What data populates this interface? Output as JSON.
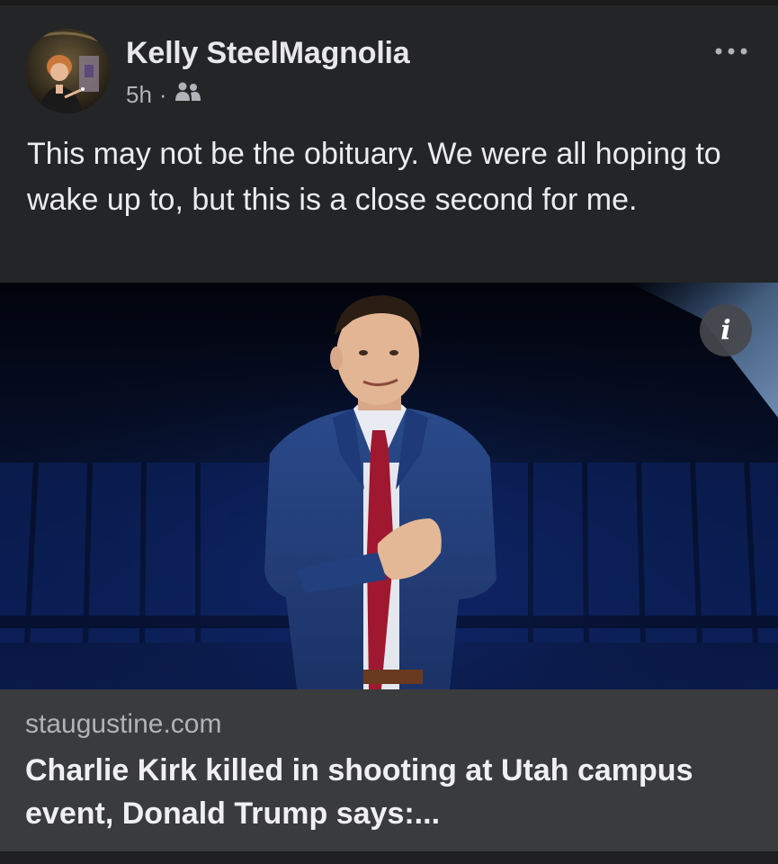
{
  "post": {
    "author_name": "Kelly SteelMagnolia",
    "timestamp": "5h",
    "separator": "·",
    "audience_icon": "friends-icon",
    "more_icon": "more-options-icon",
    "text": "This may not be the obituary. We were all hoping to wake up to, but this is a close second for me."
  },
  "photo": {
    "info_label": "i"
  },
  "link_preview": {
    "domain": "staugustine.com",
    "title": "Charlie Kirk killed in shooting at Utah campus event, Donald Trump says:..."
  },
  "colors": {
    "background": "#242526",
    "link_card": "#3a3b3c",
    "secondary_text": "#b0b3b8",
    "primary_text": "#e4e6eb"
  }
}
